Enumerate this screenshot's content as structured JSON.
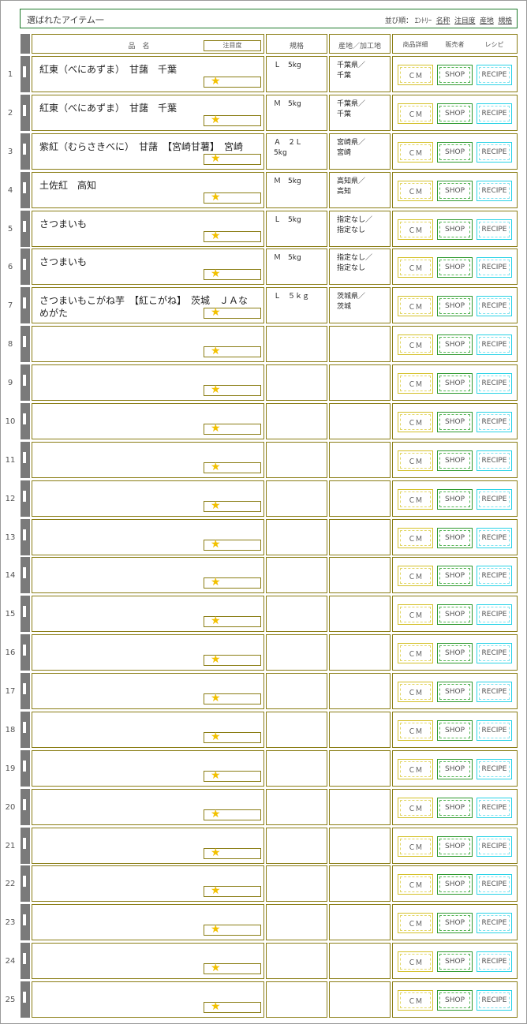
{
  "header": {
    "title": "選ばれたアイテム一",
    "sort_label": "並び順：",
    "sort_entry": "ｴﾝﾄﾘｰ",
    "sort_links": [
      "名称",
      "注目度",
      "産地",
      "規格"
    ]
  },
  "columns": {
    "name": "品　名",
    "attention": "注目度",
    "spec": "規格",
    "origin": "産地／加工地",
    "detail": "商品詳細",
    "seller": "販売者",
    "recipe": "レシピ"
  },
  "buttons": {
    "cm": "ＣＭ",
    "shop": "SHOP",
    "recipe": "RECIPE"
  },
  "rows": [
    {
      "num": "1",
      "name": "紅東（べにあずま）　甘藷　千葉",
      "spec": "Ｌ　5kg",
      "origin": "千葉県／\n千葉",
      "rating": 1
    },
    {
      "num": "2",
      "name": "紅東（べにあずま）　甘藷　千葉",
      "spec": "Ｍ　5kg",
      "origin": "千葉県／\n千葉",
      "rating": 1
    },
    {
      "num": "3",
      "name": "紫紅（むらさきべに）　甘藷　【宮崎甘薯】　宮崎",
      "spec": "Ａ　２Ｌ\n5kg",
      "origin": "宮崎県／\n宮崎",
      "rating": 1
    },
    {
      "num": "4",
      "name": "土佐紅　高知",
      "spec": "Ｍ　5kg",
      "origin": "高知県／\n高知",
      "rating": 1
    },
    {
      "num": "5",
      "name": "さつまいも",
      "spec": "Ｌ　5kg",
      "origin": "指定なし／\n指定なし",
      "rating": 1
    },
    {
      "num": "6",
      "name": "さつまいも",
      "spec": "Ｍ　5kg",
      "origin": "指定なし／\n指定なし",
      "rating": 1
    },
    {
      "num": "7",
      "name": "さつまいもこがね芋　【紅こがね】　茨城　ＪＡなめがた",
      "spec": "Ｌ　５ｋｇ",
      "origin": "茨城県／\n茨城",
      "rating": 1
    },
    {
      "num": "8",
      "name": "",
      "spec": "",
      "origin": "",
      "rating": 1
    },
    {
      "num": "9",
      "name": "",
      "spec": "",
      "origin": "",
      "rating": 1
    },
    {
      "num": "10",
      "name": "",
      "spec": "",
      "origin": "",
      "rating": 1
    },
    {
      "num": "11",
      "name": "",
      "spec": "",
      "origin": "",
      "rating": 1
    },
    {
      "num": "12",
      "name": "",
      "spec": "",
      "origin": "",
      "rating": 1
    },
    {
      "num": "13",
      "name": "",
      "spec": "",
      "origin": "",
      "rating": 1
    },
    {
      "num": "14",
      "name": "",
      "spec": "",
      "origin": "",
      "rating": 1
    },
    {
      "num": "15",
      "name": "",
      "spec": "",
      "origin": "",
      "rating": 1
    },
    {
      "num": "16",
      "name": "",
      "spec": "",
      "origin": "",
      "rating": 1
    },
    {
      "num": "17",
      "name": "",
      "spec": "",
      "origin": "",
      "rating": 1
    },
    {
      "num": "18",
      "name": "",
      "spec": "",
      "origin": "",
      "rating": 1
    },
    {
      "num": "19",
      "name": "",
      "spec": "",
      "origin": "",
      "rating": 1
    },
    {
      "num": "20",
      "name": "",
      "spec": "",
      "origin": "",
      "rating": 1
    },
    {
      "num": "21",
      "name": "",
      "spec": "",
      "origin": "",
      "rating": 1
    },
    {
      "num": "22",
      "name": "",
      "spec": "",
      "origin": "",
      "rating": 1
    },
    {
      "num": "23",
      "name": "",
      "spec": "",
      "origin": "",
      "rating": 1
    },
    {
      "num": "24",
      "name": "",
      "spec": "",
      "origin": "",
      "rating": 1
    },
    {
      "num": "25",
      "name": "",
      "spec": "",
      "origin": "",
      "rating": 1
    }
  ],
  "icons": {
    "star": "star-icon",
    "row_marker": "row-marker-icon"
  },
  "colors": {
    "border": "#8a7d14",
    "frame_green": "#1d7a2a",
    "cm": "#d4c12a",
    "shop": "#2e9a2e",
    "recipe": "#2ad3e6",
    "star": "#f2c100"
  }
}
